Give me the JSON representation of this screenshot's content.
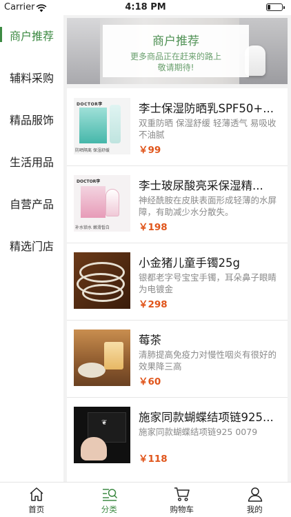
{
  "status_bar": {
    "carrier": "Carrier",
    "time": "4:18 PM",
    "battery_level": 0.2
  },
  "sidebar": {
    "items": [
      {
        "label": "商户推荐",
        "active": true
      },
      {
        "label": "辅料采购",
        "active": false
      },
      {
        "label": "精品服饰",
        "active": false
      },
      {
        "label": "生活用品",
        "active": false
      },
      {
        "label": "自营产品",
        "active": false
      },
      {
        "label": "精选门店",
        "active": false
      }
    ]
  },
  "banner": {
    "title": "商户推荐",
    "subtitle_line1": "更多商品正在赶来的路上",
    "subtitle_line2": "敬请期待!"
  },
  "products": [
    {
      "name": "李士保湿防晒乳SPF50+...",
      "desc": "双重防晒 保湿舒缓 轻薄透气 易吸收 不油腻",
      "price": "￥99",
      "thumb_brand": "DOCTOR李",
      "thumb_tag": "防晒隔离 保湿舒缓"
    },
    {
      "name": "李士玻尿酸亮采保湿精...",
      "desc": "神经酰胺在皮肤表面形成轻薄的水屏障，有助减少水分散失。",
      "price": "￥198",
      "thumb_brand": "DOCTOR李",
      "thumb_tag": "补水锁水 嫩滑皙白"
    },
    {
      "name": "小金猪儿童手镯25g",
      "desc": "银都老字号宝宝手镯，耳朵鼻子眼睛为电镀金",
      "price": "￥298"
    },
    {
      "name": "莓茶",
      "desc": "清肺提高免疫力对慢性咽炎有很好的效果降三高",
      "price": "￥60"
    },
    {
      "name": "施家同款蝴蝶结项链925...",
      "desc": "施家同款蝴蝶结项链925 0079",
      "price": "￥118"
    }
  ],
  "tabbar": {
    "tabs": [
      {
        "label": "首页",
        "icon": "home-icon",
        "active": false
      },
      {
        "label": "分类",
        "icon": "category-search-icon",
        "active": true
      },
      {
        "label": "购物车",
        "icon": "cart-icon",
        "active": false
      },
      {
        "label": "我的",
        "icon": "person-icon",
        "active": false
      }
    ]
  },
  "colors": {
    "accent": "#3d8a43",
    "price": "#e0551b"
  }
}
